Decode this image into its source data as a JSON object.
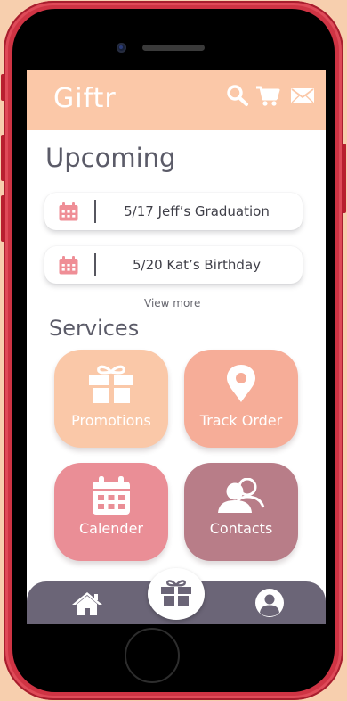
{
  "app": {
    "name": "Giftr"
  },
  "header": {
    "icons": [
      "search-icon",
      "cart-icon",
      "mail-icon"
    ]
  },
  "upcoming": {
    "title": "Upcoming",
    "events": [
      {
        "icon": "calendar-icon",
        "text": "5/17 Jeff’s Graduation"
      },
      {
        "icon": "calendar-icon",
        "text": "5/20 Kat’s Birthday"
      }
    ],
    "view_more": "View more"
  },
  "services": {
    "title": "Services",
    "tiles": [
      {
        "label": "Promotions",
        "icon": "gift-icon",
        "color": "#fac8a8"
      },
      {
        "label": "Track Order",
        "icon": "location-pin-icon",
        "color": "#f6ad98"
      },
      {
        "label": "Calender",
        "icon": "calendar-icon",
        "color": "#ea8e96"
      },
      {
        "label": "Contacts",
        "icon": "contacts-icon",
        "color": "#b87d88"
      }
    ]
  },
  "bottom_nav": {
    "items": [
      "home-icon",
      "gift-icon",
      "profile-icon"
    ]
  },
  "colors": {
    "header_bg": "#fbc8a8",
    "page_bg": "#f7cfae",
    "phone_frame": "#cf3444",
    "nav_bg": "#6b6577",
    "accent_calendar": "#ef8e96",
    "title_text": "#5b5b68"
  }
}
